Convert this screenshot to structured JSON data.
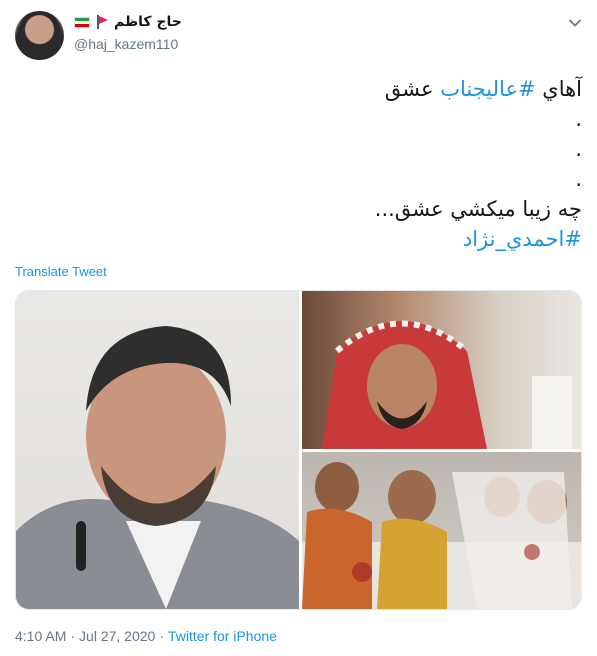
{
  "author": {
    "display_name": "حاج کاظم",
    "handle": "@haj_kazem110",
    "badges": [
      "iran-flag-icon",
      "red-pennant-icon"
    ]
  },
  "tweet": {
    "line1_plain": "آهاي ",
    "line1_hashtag": "#عاليجناب",
    "line1_tail": " عشق",
    "dots": [
      ".",
      ".",
      "."
    ],
    "line2": "چه زيبا ميكشي عشق...",
    "hashtag2": "#احمدي_نژاد"
  },
  "translate_label": "Translate Tweet",
  "media": {
    "images": [
      "portrait-smiling-man-in-grey-suit",
      "man-in-red-checkered-keffiyeh",
      "injured-children-in-hospital-beds"
    ]
  },
  "meta": {
    "time": "4:10 AM",
    "dot": "·",
    "date": "Jul 27, 2020",
    "source": "Twitter for iPhone"
  },
  "colors": {
    "link": "#1b95e0",
    "text": "#14171a",
    "secondary": "#657786",
    "border": "#e1e8ed"
  }
}
